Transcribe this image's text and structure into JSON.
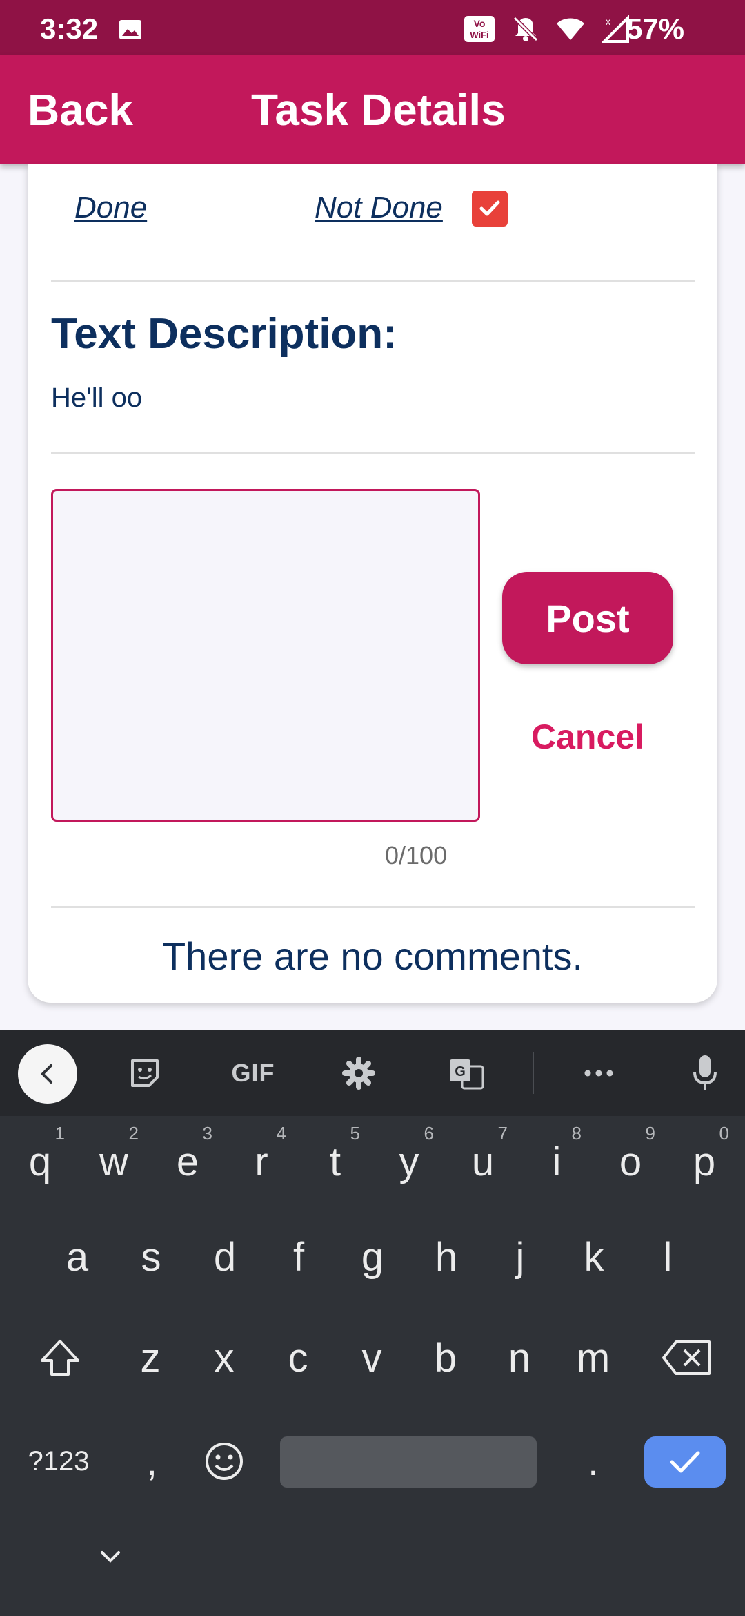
{
  "status_bar": {
    "time": "3:32",
    "battery": "57%",
    "icons": [
      "image-icon",
      "vowifi-icon",
      "bell-off-icon",
      "wifi-icon",
      "signal-icon"
    ]
  },
  "app_bar": {
    "back_label": "Back",
    "title": "Task Details"
  },
  "task": {
    "done_label": "Done",
    "not_done_label": "Not Done",
    "not_done_checked": true,
    "description_title": "Text Description:",
    "description_text": "He'll oo"
  },
  "comment_form": {
    "value": "",
    "counter": "0/100",
    "post_label": "Post",
    "cancel_label": "Cancel"
  },
  "comments": {
    "empty_message": "There are no comments."
  },
  "keyboard": {
    "toolbar": {
      "gif_label": "GIF",
      "items": [
        "collapse-icon",
        "sticker-icon",
        "gif",
        "settings-icon",
        "translate-icon",
        "more-icon",
        "mic-icon"
      ]
    },
    "row1": [
      {
        "k": "q",
        "h": "1"
      },
      {
        "k": "w",
        "h": "2"
      },
      {
        "k": "e",
        "h": "3"
      },
      {
        "k": "r",
        "h": "4"
      },
      {
        "k": "t",
        "h": "5"
      },
      {
        "k": "y",
        "h": "6"
      },
      {
        "k": "u",
        "h": "7"
      },
      {
        "k": "i",
        "h": "8"
      },
      {
        "k": "o",
        "h": "9"
      },
      {
        "k": "p",
        "h": "0"
      }
    ],
    "row2": [
      "a",
      "s",
      "d",
      "f",
      "g",
      "h",
      "j",
      "k",
      "l"
    ],
    "row3": [
      "z",
      "x",
      "c",
      "v",
      "b",
      "n",
      "m"
    ],
    "symbols_label": "?123",
    "comma": ",",
    "period": "."
  },
  "colors": {
    "status_bar": "#8f1245",
    "app_bar": "#c2185b",
    "accent": "#d81b60",
    "checkbox": "#e8413a",
    "text_dark": "#0d2f5e",
    "keyboard_bg": "#2f3237",
    "enter_key": "#5b8def"
  }
}
